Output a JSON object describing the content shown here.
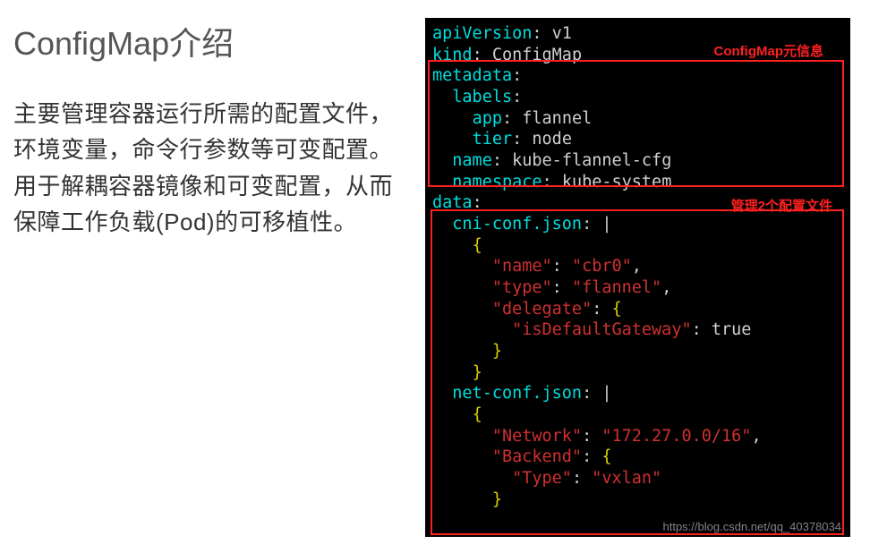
{
  "left": {
    "title": "ConfigMap介绍",
    "description": "主要管理容器运行所需的配置文件，环境变量，命令行参数等可变配置。用于解耦容器镜像和可变配置，从而保障工作负载(Pod)的可移植性。"
  },
  "code": {
    "line1_key": "apiVersion",
    "line1_val": "v1",
    "line2_key": "kind",
    "line2_val": "ConfigMap",
    "line3_key": "metadata",
    "line4_key": "labels",
    "line5_key": "app",
    "line5_val": "flannel",
    "line6_key": "tier",
    "line6_val": "node",
    "line7_key": "name",
    "line7_val": "kube-flannel-cfg",
    "line8_key": "namespace",
    "line8_val": "kube-system",
    "line9_key": "data",
    "line10_key": "cni-conf.json",
    "line10_val": "|",
    "brace_open": "{",
    "brace_close": "}",
    "cni_name_k": "\"name\"",
    "cni_name_v": "\"cbr0\"",
    "cni_type_k": "\"type\"",
    "cni_type_v": "\"flannel\"",
    "cni_del_k": "\"delegate\"",
    "cni_gw_k": "\"isDefaultGateway\"",
    "cni_gw_v": "true",
    "net_key": "net-conf.json",
    "net_val": "|",
    "net_network_k": "\"Network\"",
    "net_network_v": "\"172.27.0.0/16\"",
    "net_backend_k": "\"Backend\"",
    "net_type_k": "\"Type\"",
    "net_type_v": "\"vxlan\"",
    "comma": ","
  },
  "annotations": {
    "meta_label": "ConfigMap元信息",
    "data_label": "管理2个配置文件"
  },
  "watermark": "https://blog.csdn.net/qq_40378034"
}
